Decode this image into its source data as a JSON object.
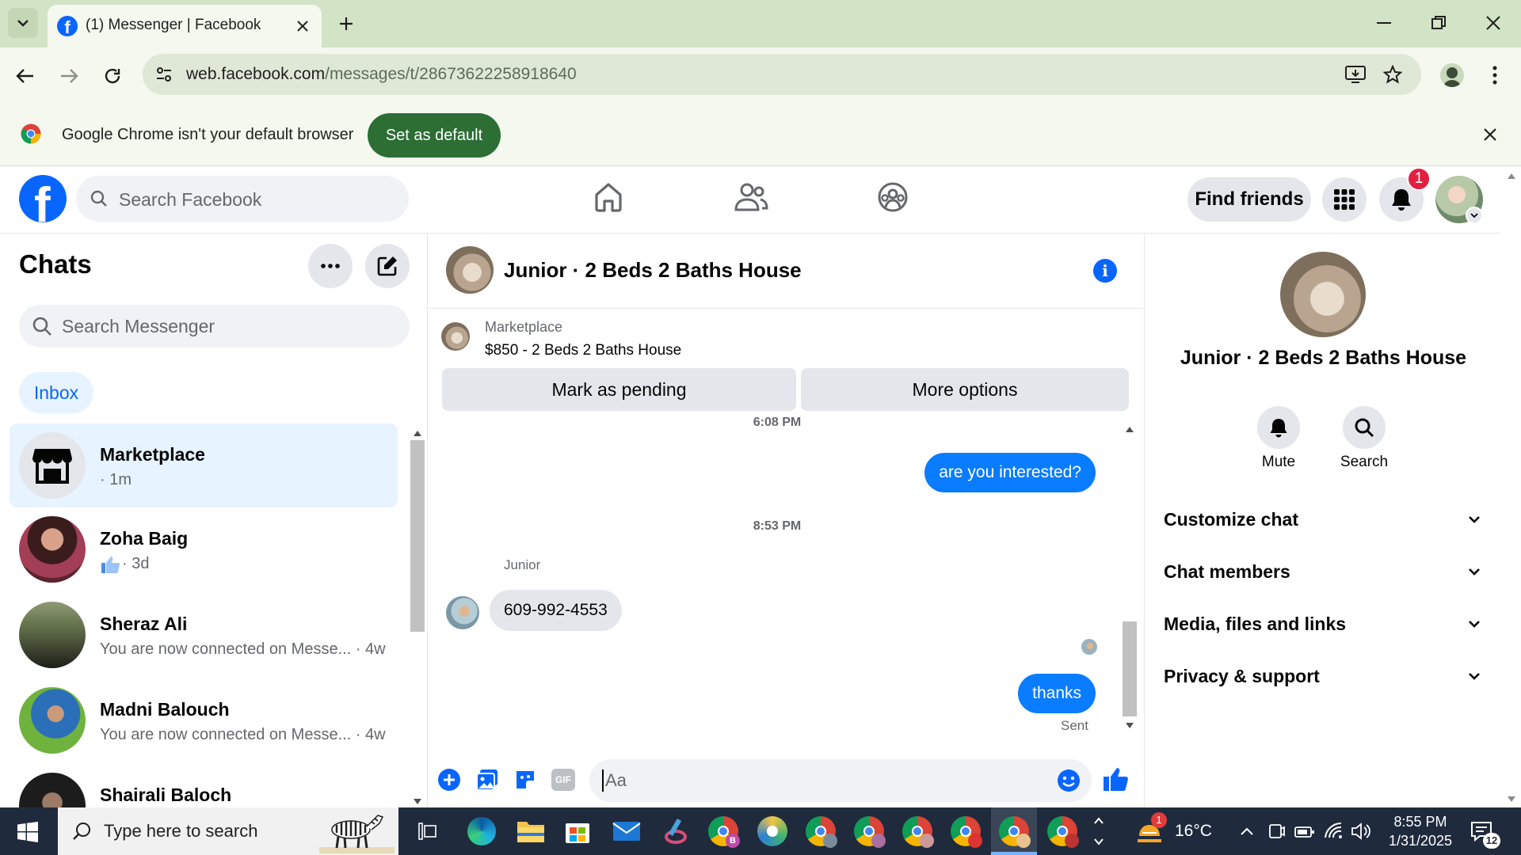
{
  "browser": {
    "tab_title": "(1) Messenger | Facebook",
    "url_domain": "web.facebook.com",
    "url_path": "/messages/t/28673622258918640",
    "default_banner_text": "Google Chrome isn't your default browser",
    "set_default_label": "Set as default"
  },
  "fb": {
    "search_placeholder": "Search Facebook",
    "find_friends": "Find friends",
    "notification_count": "1"
  },
  "chats": {
    "title": "Chats",
    "search_placeholder": "Search Messenger",
    "inbox_label": "Inbox",
    "items": [
      {
        "name": "Marketplace",
        "sub": "· 1m"
      },
      {
        "name": "Zoha Baig",
        "sub": "· 3d"
      },
      {
        "name": "Sheraz Ali",
        "sub": "You are now connected on Messe...",
        "time": "· 4w"
      },
      {
        "name": "Madni Balouch",
        "sub": "You are now connected on Messe...",
        "time": "· 4w"
      },
      {
        "name": "Shairali Baloch",
        "sub": ""
      }
    ]
  },
  "conversation": {
    "title": "Junior · 2 Beds 2 Baths House",
    "listing_source": "Marketplace",
    "listing_title": "$850 - 2 Beds 2 Baths House",
    "mark_pending": "Mark as pending",
    "more_options": "More options",
    "ts1": "6:08 PM",
    "msg1": "are you interested?",
    "ts2": "8:53 PM",
    "sender": "Junior",
    "msg2": "609-992-4553",
    "msg3": "thanks",
    "status": "Sent",
    "composer_placeholder": "Aa"
  },
  "details": {
    "title": "Junior · 2 Beds 2 Baths House",
    "mute": "Mute",
    "search": "Search",
    "sections": [
      "Customize chat",
      "Chat members",
      "Media, files and links",
      "Privacy & support"
    ]
  },
  "taskbar": {
    "search_placeholder": "Type here to search",
    "weather": "16°C",
    "weather_badge": "1",
    "time": "8:55 PM",
    "date": "1/31/2025",
    "notif_count": "12"
  },
  "colors": {
    "fb_blue": "#0866ff",
    "bubble": "#0a7cff",
    "chrome_green": "#2c6e34"
  }
}
